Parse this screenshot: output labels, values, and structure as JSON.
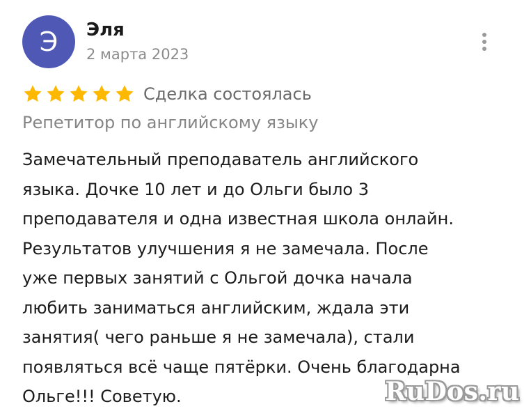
{
  "review": {
    "author": {
      "initial": "Э",
      "name": "Эля",
      "avatar_color": "#4f58b5"
    },
    "date": "2 марта 2023",
    "menu_icon": "more-vertical-icon",
    "rating": {
      "stars": 5,
      "max": 5,
      "star_color": "#ffb800"
    },
    "deal_status": "Сделка состоялась",
    "service": "Репетитор по английскому языку",
    "text_lines": [
      "Замечательный преподаватель английского",
      "языка. Дочке 10 лет и до Ольги было 3",
      "преподавателя и одна известная школа онлайн.",
      "Результатов улучшения я не замечала. После",
      "уже первых занятий с Ольгой дочка начала",
      "любить заниматься английским, ждала эти",
      "занятия( чего раньше я не замечала), стали",
      "появляться всё чаще пятёрки. Очень благодарна",
      "Ольге!!! Советую."
    ]
  },
  "watermark": {
    "text": "RuDos.ru"
  }
}
